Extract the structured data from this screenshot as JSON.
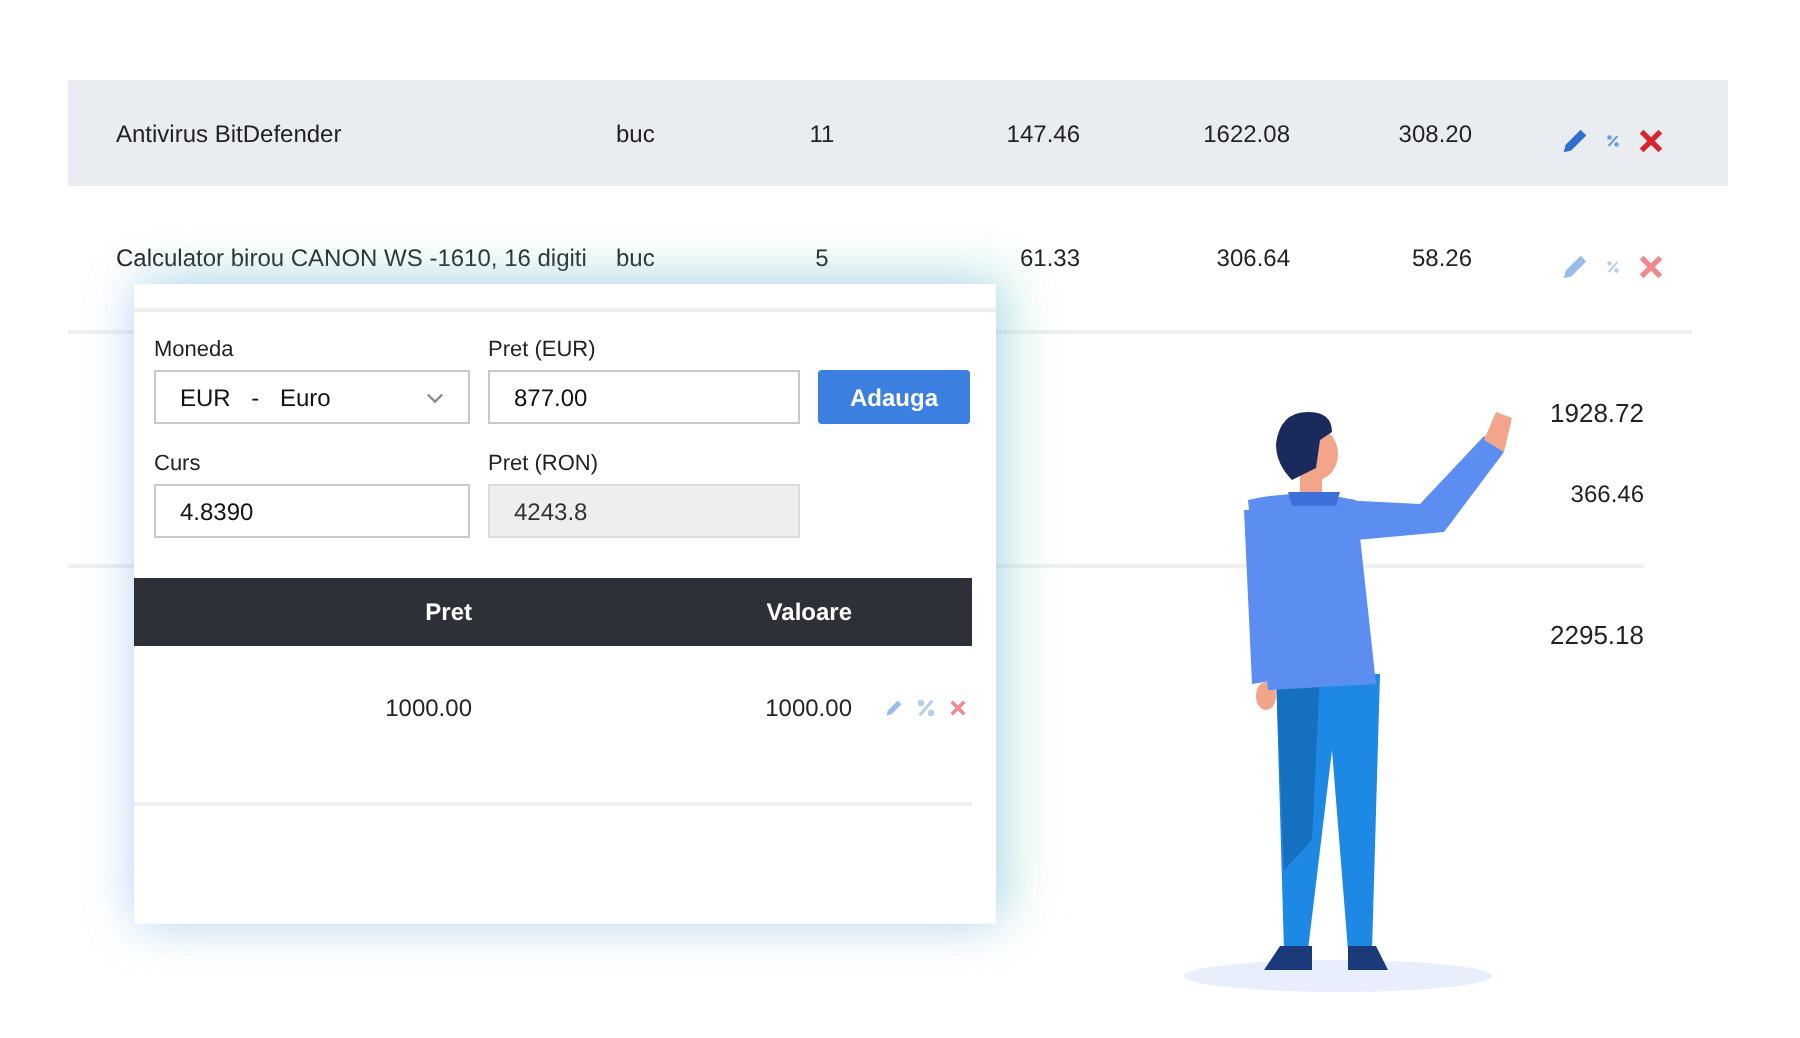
{
  "table": {
    "rows": [
      {
        "name": "Antivirus BitDefender",
        "unit": "buc",
        "quantity": "11",
        "price": "147.46",
        "total": "1622.08",
        "vat": "308.20",
        "selected": true
      },
      {
        "name": "Calculator birou CANON WS -1610, 16 digiti",
        "unit": "buc",
        "quantity": "5",
        "price": "61.33",
        "total": "306.64",
        "vat": "58.26",
        "selected": false
      }
    ]
  },
  "totals": [
    {
      "values": [
        "1928.72",
        "366.46"
      ]
    },
    {
      "values": [
        "2295.18"
      ]
    }
  ],
  "form": {
    "fields": [
      {
        "label": "Moneda",
        "value": "EUR - Euro",
        "kind": "select",
        "disabled": false
      },
      {
        "label": "Pret (EUR)",
        "value": "877.00",
        "kind": "input",
        "disabled": false
      },
      {
        "label": "Curs",
        "value": "4.8390",
        "kind": "input",
        "disabled": false
      },
      {
        "label": "Pret (RON)",
        "value": "4243.8",
        "kind": "input",
        "disabled": true
      }
    ],
    "button": "Adauga"
  },
  "items": {
    "columns": [
      "Pret",
      "Valoare"
    ],
    "rows": [
      {
        "cells": [
          "1000.00",
          "1000.00"
        ]
      }
    ]
  }
}
